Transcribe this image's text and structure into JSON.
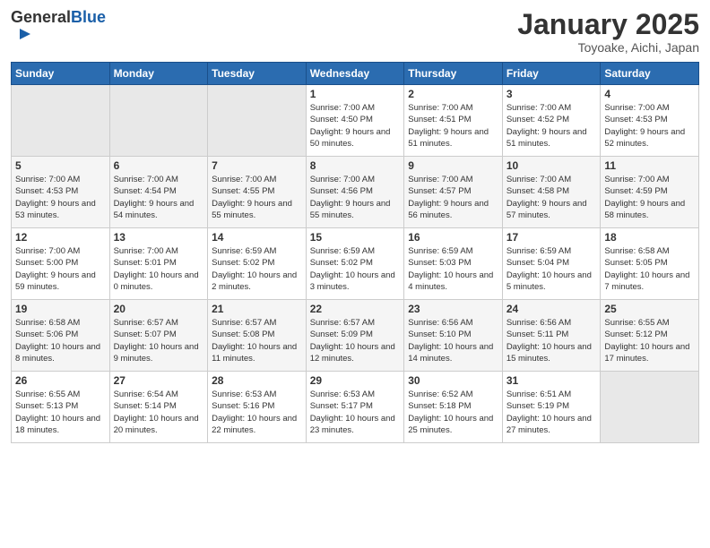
{
  "header": {
    "logo_general": "General",
    "logo_blue": "Blue",
    "month_year": "January 2025",
    "location": "Toyoake, Aichi, Japan"
  },
  "weekdays": [
    "Sunday",
    "Monday",
    "Tuesday",
    "Wednesday",
    "Thursday",
    "Friday",
    "Saturday"
  ],
  "weeks": [
    [
      {
        "day": "",
        "info": ""
      },
      {
        "day": "",
        "info": ""
      },
      {
        "day": "",
        "info": ""
      },
      {
        "day": "1",
        "info": "Sunrise: 7:00 AM\nSunset: 4:50 PM\nDaylight: 9 hours\nand 50 minutes."
      },
      {
        "day": "2",
        "info": "Sunrise: 7:00 AM\nSunset: 4:51 PM\nDaylight: 9 hours\nand 51 minutes."
      },
      {
        "day": "3",
        "info": "Sunrise: 7:00 AM\nSunset: 4:52 PM\nDaylight: 9 hours\nand 51 minutes."
      },
      {
        "day": "4",
        "info": "Sunrise: 7:00 AM\nSunset: 4:53 PM\nDaylight: 9 hours\nand 52 minutes."
      }
    ],
    [
      {
        "day": "5",
        "info": "Sunrise: 7:00 AM\nSunset: 4:53 PM\nDaylight: 9 hours\nand 53 minutes."
      },
      {
        "day": "6",
        "info": "Sunrise: 7:00 AM\nSunset: 4:54 PM\nDaylight: 9 hours\nand 54 minutes."
      },
      {
        "day": "7",
        "info": "Sunrise: 7:00 AM\nSunset: 4:55 PM\nDaylight: 9 hours\nand 55 minutes."
      },
      {
        "day": "8",
        "info": "Sunrise: 7:00 AM\nSunset: 4:56 PM\nDaylight: 9 hours\nand 55 minutes."
      },
      {
        "day": "9",
        "info": "Sunrise: 7:00 AM\nSunset: 4:57 PM\nDaylight: 9 hours\nand 56 minutes."
      },
      {
        "day": "10",
        "info": "Sunrise: 7:00 AM\nSunset: 4:58 PM\nDaylight: 9 hours\nand 57 minutes."
      },
      {
        "day": "11",
        "info": "Sunrise: 7:00 AM\nSunset: 4:59 PM\nDaylight: 9 hours\nand 58 minutes."
      }
    ],
    [
      {
        "day": "12",
        "info": "Sunrise: 7:00 AM\nSunset: 5:00 PM\nDaylight: 9 hours\nand 59 minutes."
      },
      {
        "day": "13",
        "info": "Sunrise: 7:00 AM\nSunset: 5:01 PM\nDaylight: 10 hours\nand 0 minutes."
      },
      {
        "day": "14",
        "info": "Sunrise: 6:59 AM\nSunset: 5:02 PM\nDaylight: 10 hours\nand 2 minutes."
      },
      {
        "day": "15",
        "info": "Sunrise: 6:59 AM\nSunset: 5:02 PM\nDaylight: 10 hours\nand 3 minutes."
      },
      {
        "day": "16",
        "info": "Sunrise: 6:59 AM\nSunset: 5:03 PM\nDaylight: 10 hours\nand 4 minutes."
      },
      {
        "day": "17",
        "info": "Sunrise: 6:59 AM\nSunset: 5:04 PM\nDaylight: 10 hours\nand 5 minutes."
      },
      {
        "day": "18",
        "info": "Sunrise: 6:58 AM\nSunset: 5:05 PM\nDaylight: 10 hours\nand 7 minutes."
      }
    ],
    [
      {
        "day": "19",
        "info": "Sunrise: 6:58 AM\nSunset: 5:06 PM\nDaylight: 10 hours\nand 8 minutes."
      },
      {
        "day": "20",
        "info": "Sunrise: 6:57 AM\nSunset: 5:07 PM\nDaylight: 10 hours\nand 9 minutes."
      },
      {
        "day": "21",
        "info": "Sunrise: 6:57 AM\nSunset: 5:08 PM\nDaylight: 10 hours\nand 11 minutes."
      },
      {
        "day": "22",
        "info": "Sunrise: 6:57 AM\nSunset: 5:09 PM\nDaylight: 10 hours\nand 12 minutes."
      },
      {
        "day": "23",
        "info": "Sunrise: 6:56 AM\nSunset: 5:10 PM\nDaylight: 10 hours\nand 14 minutes."
      },
      {
        "day": "24",
        "info": "Sunrise: 6:56 AM\nSunset: 5:11 PM\nDaylight: 10 hours\nand 15 minutes."
      },
      {
        "day": "25",
        "info": "Sunrise: 6:55 AM\nSunset: 5:12 PM\nDaylight: 10 hours\nand 17 minutes."
      }
    ],
    [
      {
        "day": "26",
        "info": "Sunrise: 6:55 AM\nSunset: 5:13 PM\nDaylight: 10 hours\nand 18 minutes."
      },
      {
        "day": "27",
        "info": "Sunrise: 6:54 AM\nSunset: 5:14 PM\nDaylight: 10 hours\nand 20 minutes."
      },
      {
        "day": "28",
        "info": "Sunrise: 6:53 AM\nSunset: 5:16 PM\nDaylight: 10 hours\nand 22 minutes."
      },
      {
        "day": "29",
        "info": "Sunrise: 6:53 AM\nSunset: 5:17 PM\nDaylight: 10 hours\nand 23 minutes."
      },
      {
        "day": "30",
        "info": "Sunrise: 6:52 AM\nSunset: 5:18 PM\nDaylight: 10 hours\nand 25 minutes."
      },
      {
        "day": "31",
        "info": "Sunrise: 6:51 AM\nSunset: 5:19 PM\nDaylight: 10 hours\nand 27 minutes."
      },
      {
        "day": "",
        "info": ""
      }
    ]
  ]
}
